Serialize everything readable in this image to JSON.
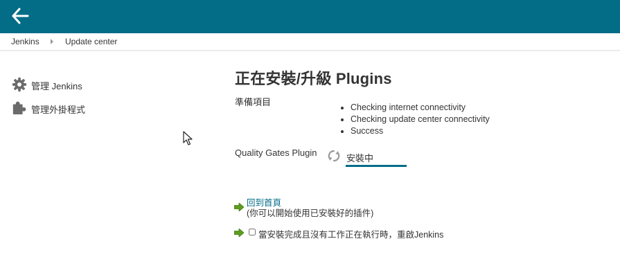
{
  "header": {
    "back_icon": "arrow-left-icon",
    "background_color": "#036d87"
  },
  "breadcrumbs": {
    "items": [
      "Jenkins",
      "Update center"
    ],
    "separator_icon": "triangle-right-icon"
  },
  "sidebar": {
    "items": [
      {
        "label": "管理 Jenkins",
        "icon": "gear-icon"
      },
      {
        "label": "管理外掛程式",
        "icon": "puzzle-piece-icon"
      }
    ]
  },
  "main": {
    "heading": "正在安裝/升級 Plugins",
    "preparation": {
      "label": "準備項目",
      "checks": [
        "Checking internet connectivity",
        "Checking update center connectivity",
        "Success"
      ]
    },
    "plugins": [
      {
        "name": "Quality Gates Plugin",
        "status": "安裝中",
        "status_icon": "refresh-spinner-icon",
        "progress": 1.0
      }
    ],
    "go_home": {
      "link": "回到首頁",
      "note": "(你可以開始使用已安裝好的插件)",
      "icon": "green-arrow-icon"
    },
    "restart": {
      "label": "當安裝完成且沒有工作正在執行時，重啟Jenkins",
      "checked": false,
      "icon": "green-arrow-icon"
    }
  },
  "colors": {
    "accent": "#036d87",
    "go_arrow": "#5c9c1e"
  }
}
